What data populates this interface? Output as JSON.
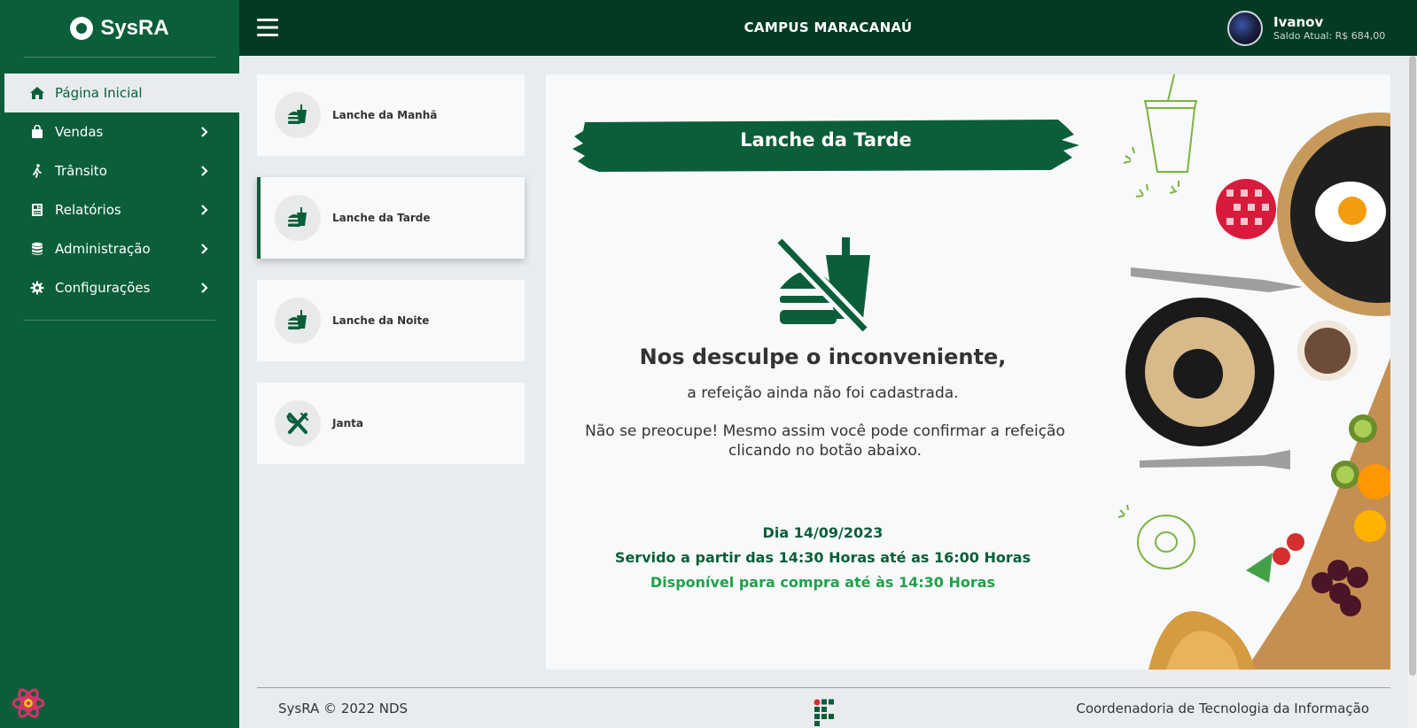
{
  "app": {
    "brand": "SysRA",
    "campus": "CAMPUS MARACANAÚ"
  },
  "user": {
    "name": "Ivanov",
    "balance": "Saldo Atual: R$ 684,00"
  },
  "sidebar": {
    "items": [
      {
        "label": "Página Inicial",
        "icon": "home-icon",
        "active": true
      },
      {
        "label": "Vendas",
        "icon": "shopping-bag-icon"
      },
      {
        "label": "Trânsito",
        "icon": "walking-icon"
      },
      {
        "label": "Relatórios",
        "icon": "newspaper-icon"
      },
      {
        "label": "Administração",
        "icon": "database-icon"
      },
      {
        "label": "Configurações",
        "icon": "gear-icon"
      }
    ]
  },
  "meals": [
    {
      "label": "Lanche da Manhã",
      "icon": "burger-drink-icon"
    },
    {
      "label": "Lanche da Tarde",
      "icon": "burger-drink-icon",
      "active": true
    },
    {
      "label": "Lanche da Noite",
      "icon": "burger-drink-icon"
    },
    {
      "label": "Janta",
      "icon": "utensils-icon"
    }
  ],
  "panel": {
    "title": "Lanche da Tarde",
    "message_title": "Nos desculpe o inconveniente,",
    "message_sub": "a refeição ainda não foi cadastrada.",
    "message_body": "Não se preocupe! Mesmo assim você pode confirmar a refeição clicando no botão abaixo.",
    "date": "Dia 14/09/2023",
    "served": "Servido a partir das 14:30 Horas até as 16:00 Horas",
    "available": "Disponível para compra até às 14:30 Horas"
  },
  "footer": {
    "left": "SysRA © 2022 NDS",
    "right": "Coordenadoria de Tecnologia da Informação"
  },
  "colors": {
    "brand_green": "#0b5e3a",
    "topbar_green": "#023a23",
    "accent_green": "#21a04b"
  }
}
